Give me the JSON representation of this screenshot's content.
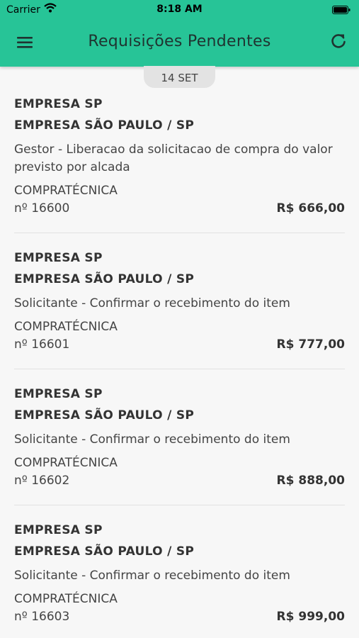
{
  "status_bar": {
    "carrier": "Carrier",
    "time": "8:18 AM"
  },
  "header": {
    "title": "Requisições Pendentes",
    "menu_icon": "hamburger-menu-icon",
    "refresh_icon": "refresh-icon"
  },
  "date_group": "14 SET",
  "requests": [
    {
      "company": "EMPRESA SP",
      "branch": "EMPRESA SÃO PAULO / SP",
      "task": "Gestor - Liberacao da solicitacao de compra do valor previsto por alcada",
      "type": "COMPRATÉCNICA",
      "number": "nº 16600",
      "value": "R$ 666,00"
    },
    {
      "company": "EMPRESA SP",
      "branch": "EMPRESA SÃO PAULO / SP",
      "task": "Solicitante - Confirmar o recebimento do item",
      "type": "COMPRATÉCNICA",
      "number": "nº 16601",
      "value": "R$ 777,00"
    },
    {
      "company": "EMPRESA SP",
      "branch": "EMPRESA SÃO PAULO / SP",
      "task": "Solicitante - Confirmar o recebimento do item",
      "type": "COMPRATÉCNICA",
      "number": "nº 16602",
      "value": "R$ 888,00"
    },
    {
      "company": "EMPRESA SP",
      "branch": "EMPRESA SÃO PAULO / SP",
      "task": "Solicitante - Confirmar o recebimento do item",
      "type": "COMPRATÉCNICA",
      "number": "nº 16603",
      "value": "R$ 999,00"
    }
  ],
  "colors": {
    "header_bg": "#27c497",
    "background": "#f7f7f7"
  }
}
